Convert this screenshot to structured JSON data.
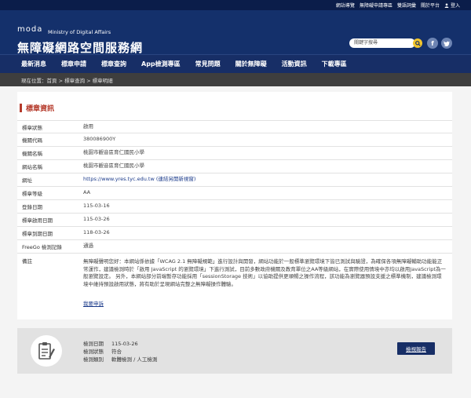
{
  "topbar": {
    "links": [
      "網站導覽",
      "無障礙申請專區",
      "雙語詞彙",
      "關於平台"
    ],
    "login": "登入"
  },
  "header": {
    "logo_text": "moda",
    "ministry": "Ministry of Digital Affairs",
    "site_title": "無障礙網路空間服務網",
    "search_placeholder": "關鍵字搜尋",
    "social": [
      "f",
      "t"
    ]
  },
  "nav": {
    "items": [
      "最新消息",
      "標章申請",
      "標章查詢",
      "App檢測專區",
      "常見問題",
      "關於無障礙",
      "活動資訊",
      "下載專區"
    ]
  },
  "breadcrumb": "現在位置：首頁 > 標章查詢 > 標章明細",
  "section_title": "標章資訊",
  "details": [
    {
      "key": "標章狀態",
      "value": "啟用"
    },
    {
      "key": "機關代碼",
      "value": "380086900Y"
    },
    {
      "key": "機關名稱",
      "value": "桃園市觀音區育仁國民小學"
    },
    {
      "key": "網站名稱",
      "value": "桃園市觀音區育仁國民小學"
    },
    {
      "key": "網址",
      "value": "https://www.yres.tyc.edu.tw (連結另開新視窗)"
    },
    {
      "key": "標章等級",
      "value": "AA"
    },
    {
      "key": "登錄日期",
      "value": "115-03-16"
    },
    {
      "key": "標章啟用日期",
      "value": "115-03-26"
    },
    {
      "key": "標章到期日期",
      "value": "118-03-26"
    },
    {
      "key": "FreeGo 檢測記錄",
      "value": "通過"
    }
  ],
  "remarks_key": "備註",
  "remarks": "無障礙聲明您好：本網站係依據「WCAG 2.1 無障礙規範」進行設計與開發，網站功能於一般標準瀏覽環境下皆已測試與驗證，為確保各項無障礙輔助功能能正常運作，建議檢測時於「啟用 JavaScript 的瀏覽環境」下進行測試，目前多數政府機關及教育單位之AA等級網站，在實際使用情境中亦均以啟用JavaScript為一般瀏覽設定。 另外，本網站部分前端暫存功能採用「sessionStorage 技術」以協助提供更順暢之操作流程，該功能為瀏覽器預設支援之標準機制，建議檢測環境中維持預設啟用狀態，將有助於呈現網站完整之無障礙操作體驗。",
  "changes_link": "我要申訴",
  "inspection": {
    "date_label": "檢測日期",
    "date": "115-03-26",
    "status_label": "檢測狀態",
    "status": "符合",
    "type_label": "檢測類別",
    "type": "軟體檢測 / 人工檢測",
    "report_button": "檢視報告"
  }
}
